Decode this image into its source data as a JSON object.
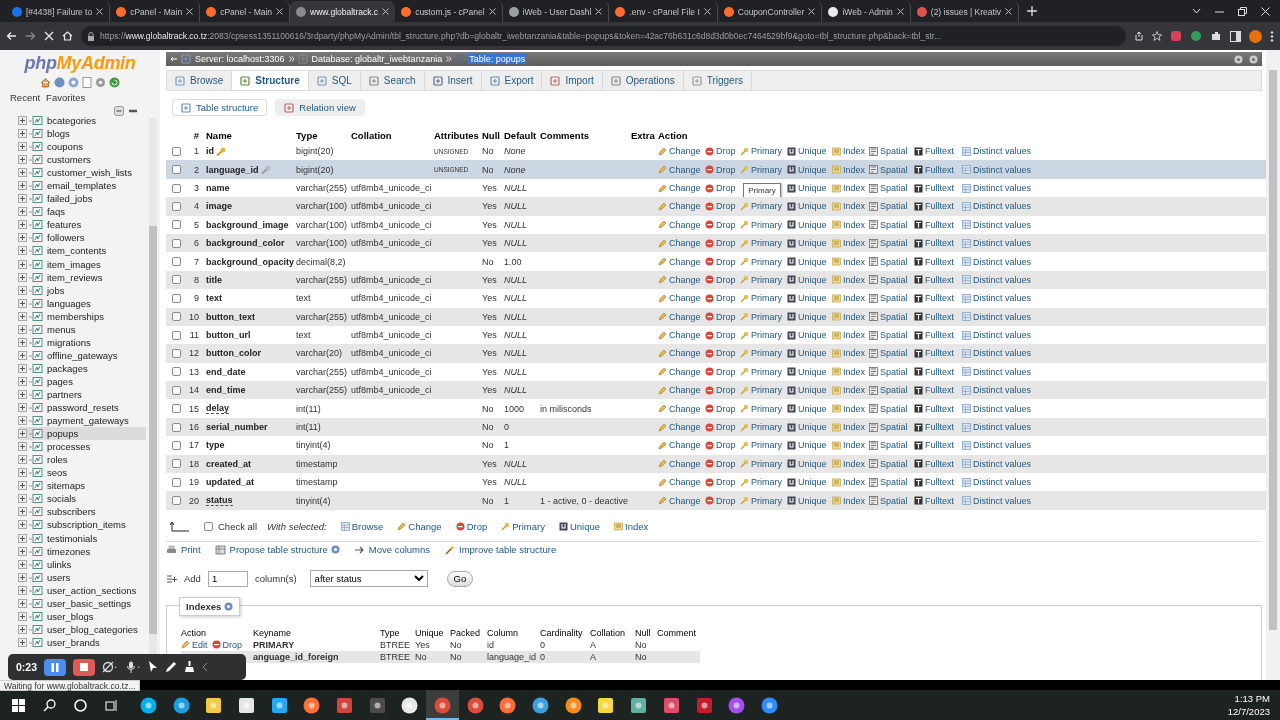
{
  "browser": {
    "tabs": [
      {
        "title": "[#4438] Failure to",
        "color": "#1a73e8",
        "selected": false
      },
      {
        "title": "cPanel - Main",
        "color": "#ff6c2c",
        "selected": false
      },
      {
        "title": "cPanel - Main",
        "color": "#ff6c2c",
        "selected": false
      },
      {
        "title": "www.globaltrack.c",
        "color": "#8a8a8a",
        "selected": true
      },
      {
        "title": "custom.js - cPanel",
        "color": "#ff6c2c",
        "selected": false
      },
      {
        "title": "iWeb - User Dashl",
        "color": "#9aa0a6",
        "selected": false
      },
      {
        "title": ".env - cPanel File I",
        "color": "#ff6c2c",
        "selected": false
      },
      {
        "title": "CouponController",
        "color": "#ff6c2c",
        "selected": false
      },
      {
        "title": "iWeb - Admin",
        "color": "#e8eaed",
        "selected": false
      },
      {
        "title": "(2) issues | Kreativ",
        "color": "#e0524a",
        "selected": false
      }
    ],
    "url": {
      "scheme": "https://",
      "host": "www.globaltrack.co.tz",
      "path": ":2083/cpsess1351100616/3rdparty/phpMyAdmin/tbl_structure.php?db=globaltr_iwebtanzania&table=popups&token=42ac76b631c6d8d3d0b0ec7464529bf9&goto=tbl_structure.php&back=tbl_str..."
    }
  },
  "sidebar": {
    "logo": [
      "php",
      "MyAdmin"
    ],
    "tabs": [
      {
        "label": "Recent"
      },
      {
        "label": "Favorites"
      }
    ],
    "tables": [
      {
        "name": "bcategories",
        "selected": false
      },
      {
        "name": "blogs",
        "selected": false
      },
      {
        "name": "coupons",
        "selected": false
      },
      {
        "name": "customers",
        "selected": false
      },
      {
        "name": "customer_wish_lists",
        "selected": false
      },
      {
        "name": "email_templates",
        "selected": false
      },
      {
        "name": "failed_jobs",
        "selected": false
      },
      {
        "name": "faqs",
        "selected": false
      },
      {
        "name": "features",
        "selected": false
      },
      {
        "name": "followers",
        "selected": false
      },
      {
        "name": "item_contents",
        "selected": false
      },
      {
        "name": "item_images",
        "selected": false
      },
      {
        "name": "item_reviews",
        "selected": false
      },
      {
        "name": "jobs",
        "selected": false
      },
      {
        "name": "languages",
        "selected": false
      },
      {
        "name": "memberships",
        "selected": false
      },
      {
        "name": "menus",
        "selected": false
      },
      {
        "name": "migrations",
        "selected": false
      },
      {
        "name": "offline_gateways",
        "selected": false
      },
      {
        "name": "packages",
        "selected": false
      },
      {
        "name": "pages",
        "selected": false
      },
      {
        "name": "partners",
        "selected": false
      },
      {
        "name": "password_resets",
        "selected": false
      },
      {
        "name": "payment_gateways",
        "selected": false
      },
      {
        "name": "popups",
        "selected": true
      },
      {
        "name": "processes",
        "selected": false
      },
      {
        "name": "roles",
        "selected": false
      },
      {
        "name": "seos",
        "selected": false
      },
      {
        "name": "sitemaps",
        "selected": false
      },
      {
        "name": "socials",
        "selected": false
      },
      {
        "name": "subscribers",
        "selected": false
      },
      {
        "name": "subscription_items",
        "selected": false
      },
      {
        "name": "testimonials",
        "selected": false
      },
      {
        "name": "timezones",
        "selected": false
      },
      {
        "name": "ulinks",
        "selected": false
      },
      {
        "name": "users",
        "selected": false
      },
      {
        "name": "user_action_sections",
        "selected": false
      },
      {
        "name": "user_basic_settings",
        "selected": false
      },
      {
        "name": "user_blogs",
        "selected": false
      },
      {
        "name": "user_blog_categories",
        "selected": false
      },
      {
        "name": "user_brands",
        "selected": false
      }
    ]
  },
  "breadcrumb": [
    {
      "label": "Server: localhost:3306",
      "selected": false
    },
    {
      "label": "Database: globaltr_iwebtanzania",
      "selected": false
    },
    {
      "label": "Table: popups",
      "selected": true
    }
  ],
  "tabs": [
    {
      "label": "Browse",
      "selected": false
    },
    {
      "label": "Structure",
      "selected": true
    },
    {
      "label": "SQL",
      "selected": false
    },
    {
      "label": "Search",
      "selected": false
    },
    {
      "label": "Insert",
      "selected": false
    },
    {
      "label": "Export",
      "selected": false
    },
    {
      "label": "Import",
      "selected": false
    },
    {
      "label": "Operations",
      "selected": false
    },
    {
      "label": "Triggers",
      "selected": false
    }
  ],
  "subtabs": [
    {
      "label": "Table structure",
      "selected": true
    },
    {
      "label": "Relation view",
      "selected": false
    }
  ],
  "structure": {
    "columns": [
      "#",
      "Name",
      "Type",
      "Collation",
      "Attributes",
      "Null",
      "Default",
      "Comments",
      "Extra",
      "Action"
    ],
    "rows": [
      {
        "num": "1",
        "name": "id",
        "kind": "primary",
        "type": "bigint(20)",
        "attributes": "UNSIGNED",
        "null": "No",
        "default": "None",
        "default_special": true,
        "checked": false,
        "highlighted": false,
        "commented": false,
        "actions": [
          "Change",
          "Drop",
          "Primary",
          "Unique",
          "Index",
          "Spatial",
          "Fulltext",
          "Distinct values"
        ]
      },
      {
        "num": "2",
        "name": "language_id",
        "kind": "index",
        "type": "bigint(20)",
        "attributes": "UNSIGNED",
        "null": "No",
        "default": "None",
        "default_special": true,
        "checked": false,
        "highlighted": true,
        "commented": false,
        "actions": [
          "Change",
          "Drop",
          "Primary",
          "Unique",
          "Index",
          "Spatial",
          "Fulltext",
          "Distinct values"
        ]
      },
      {
        "num": "3",
        "name": "name",
        "type": "varchar(255)",
        "collation": "utf8mb4_unicode_ci",
        "null": "Yes",
        "default": "NULL",
        "default_special": true,
        "checked": false,
        "highlighted": false,
        "commented": false,
        "tooltip": "Primary",
        "actions": [
          "Change",
          "Drop",
          "Unique",
          "Index",
          "Spatial",
          "Fulltext",
          "Distinct values"
        ]
      },
      {
        "num": "4",
        "name": "image",
        "type": "varchar(100)",
        "collation": "utf8mb4_unicode_ci",
        "null": "Yes",
        "default": "NULL",
        "default_special": true,
        "checked": false,
        "highlighted": false,
        "commented": false,
        "actions": [
          "Change",
          "Drop",
          "Primary",
          "Unique",
          "Index",
          "Spatial",
          "Fulltext",
          "Distinct values"
        ]
      },
      {
        "num": "5",
        "name": "background_image",
        "type": "varchar(100)",
        "collation": "utf8mb4_unicode_ci",
        "null": "Yes",
        "default": "NULL",
        "default_special": true,
        "checked": false,
        "highlighted": false,
        "commented": false,
        "actions": [
          "Change",
          "Drop",
          "Primary",
          "Unique",
          "Index",
          "Spatial",
          "Fulltext",
          "Distinct values"
        ]
      },
      {
        "num": "6",
        "name": "background_color",
        "type": "varchar(100)",
        "collation": "utf8mb4_unicode_ci",
        "null": "Yes",
        "default": "NULL",
        "default_special": true,
        "checked": false,
        "highlighted": false,
        "commented": false,
        "actions": [
          "Change",
          "Drop",
          "Primary",
          "Unique",
          "Index",
          "Spatial",
          "Fulltext",
          "Distinct values"
        ]
      },
      {
        "num": "7",
        "name": "background_opacity",
        "type": "decimal(8,2)",
        "null": "No",
        "default": "1.00",
        "default_special": false,
        "checked": false,
        "highlighted": false,
        "commented": false,
        "actions": [
          "Change",
          "Drop",
          "Primary",
          "Unique",
          "Index",
          "Spatial",
          "Fulltext",
          "Distinct values"
        ]
      },
      {
        "num": "8",
        "name": "title",
        "type": "varchar(255)",
        "collation": "utf8mb4_unicode_ci",
        "null": "Yes",
        "default": "NULL",
        "default_special": true,
        "checked": false,
        "highlighted": false,
        "commented": false,
        "actions": [
          "Change",
          "Drop",
          "Primary",
          "Unique",
          "Index",
          "Spatial",
          "Fulltext",
          "Distinct values"
        ]
      },
      {
        "num": "9",
        "name": "text",
        "type": "text",
        "collation": "utf8mb4_unicode_ci",
        "null": "Yes",
        "default": "NULL",
        "default_special": true,
        "checked": false,
        "highlighted": false,
        "commented": false,
        "actions": [
          "Change",
          "Drop",
          "Primary",
          "Unique",
          "Index",
          "Spatial",
          "Fulltext",
          "Distinct values"
        ]
      },
      {
        "num": "10",
        "name": "button_text",
        "type": "varchar(255)",
        "collation": "utf8mb4_unicode_ci",
        "null": "Yes",
        "default": "NULL",
        "default_special": true,
        "checked": false,
        "highlighted": false,
        "commented": false,
        "actions": [
          "Change",
          "Drop",
          "Primary",
          "Unique",
          "Index",
          "Spatial",
          "Fulltext",
          "Distinct values"
        ]
      },
      {
        "num": "11",
        "name": "button_url",
        "type": "text",
        "collation": "utf8mb4_unicode_ci",
        "null": "Yes",
        "default": "NULL",
        "default_special": true,
        "checked": false,
        "highlighted": false,
        "commented": false,
        "actions": [
          "Change",
          "Drop",
          "Primary",
          "Unique",
          "Index",
          "Spatial",
          "Fulltext",
          "Distinct values"
        ]
      },
      {
        "num": "12",
        "name": "button_color",
        "type": "varchar(20)",
        "collation": "utf8mb4_unicode_ci",
        "null": "Yes",
        "default": "NULL",
        "default_special": true,
        "checked": false,
        "highlighted": false,
        "commented": false,
        "actions": [
          "Change",
          "Drop",
          "Primary",
          "Unique",
          "Index",
          "Spatial",
          "Fulltext",
          "Distinct values"
        ]
      },
      {
        "num": "13",
        "name": "end_date",
        "type": "varchar(255)",
        "collation": "utf8mb4_unicode_ci",
        "null": "Yes",
        "default": "NULL",
        "default_special": true,
        "checked": false,
        "highlighted": false,
        "commented": false,
        "actions": [
          "Change",
          "Drop",
          "Primary",
          "Unique",
          "Index",
          "Spatial",
          "Fulltext",
          "Distinct values"
        ]
      },
      {
        "num": "14",
        "name": "end_time",
        "type": "varchar(255)",
        "collation": "utf8mb4_unicode_ci",
        "null": "Yes",
        "default": "NULL",
        "default_special": true,
        "checked": false,
        "highlighted": false,
        "commented": false,
        "actions": [
          "Change",
          "Drop",
          "Primary",
          "Unique",
          "Index",
          "Spatial",
          "Fulltext",
          "Distinct values"
        ]
      },
      {
        "num": "15",
        "name": "delay",
        "type": "int(11)",
        "null": "No",
        "default": "1000",
        "default_special": false,
        "comments": "in milisconds",
        "checked": false,
        "highlighted": false,
        "commented": true,
        "actions": [
          "Change",
          "Drop",
          "Primary",
          "Unique",
          "Index",
          "Spatial",
          "Fulltext",
          "Distinct values"
        ]
      },
      {
        "num": "16",
        "name": "serial_number",
        "type": "int(11)",
        "null": "No",
        "default": "0",
        "default_special": false,
        "checked": false,
        "highlighted": false,
        "commented": false,
        "actions": [
          "Change",
          "Drop",
          "Primary",
          "Unique",
          "Index",
          "Spatial",
          "Fulltext",
          "Distinct values"
        ]
      },
      {
        "num": "17",
        "name": "type",
        "type": "tinyint(4)",
        "null": "No",
        "default": "1",
        "default_special": false,
        "checked": false,
        "highlighted": false,
        "commented": false,
        "actions": [
          "Change",
          "Drop",
          "Primary",
          "Unique",
          "Index",
          "Spatial",
          "Fulltext",
          "Distinct values"
        ]
      },
      {
        "num": "18",
        "name": "created_at",
        "type": "timestamp",
        "null": "Yes",
        "default": "NULL",
        "default_special": true,
        "checked": false,
        "highlighted": false,
        "commented": false,
        "actions": [
          "Change",
          "Drop",
          "Primary",
          "Unique",
          "Index",
          "Spatial",
          "Fulltext",
          "Distinct values"
        ]
      },
      {
        "num": "19",
        "name": "updated_at",
        "type": "timestamp",
        "null": "Yes",
        "default": "NULL",
        "default_special": true,
        "checked": false,
        "highlighted": false,
        "commented": false,
        "actions": [
          "Change",
          "Drop",
          "Primary",
          "Unique",
          "Index",
          "Spatial",
          "Fulltext",
          "Distinct values"
        ]
      },
      {
        "num": "20",
        "name": "status",
        "type": "tinyint(4)",
        "null": "No",
        "default": "1",
        "default_special": false,
        "comments": "1 - active, 0 - deactive",
        "checked": false,
        "highlighted": false,
        "commented": true,
        "actions": [
          "Change",
          "Drop",
          "Primary",
          "Unique",
          "Index",
          "Spatial",
          "Fulltext",
          "Distinct values"
        ]
      }
    ]
  },
  "bulk": {
    "check_all": {
      "label": "Check all",
      "checked": false
    },
    "with_selected": "With selected:",
    "actions": [
      "Browse",
      "Change",
      "Drop",
      "Primary",
      "Unique",
      "Index"
    ]
  },
  "tools": [
    {
      "label": "Print",
      "help": false
    },
    {
      "label": "Propose table structure",
      "help": true
    },
    {
      "label": "Move columns",
      "help": false
    },
    {
      "label": "Improve table structure",
      "help": false
    }
  ],
  "add": {
    "label": "Add",
    "value": "1",
    "unit": "column(s)",
    "position": "after status",
    "button": "Go"
  },
  "indexes": {
    "title": "Indexes",
    "columns": [
      "Action",
      "Keyname",
      "Type",
      "Unique",
      "Packed",
      "Column",
      "Cardinality",
      "Collation",
      "Null",
      "Comment"
    ],
    "rows": [
      {
        "actions": [
          "Edit",
          "Drop"
        ],
        "keyname": "PRIMARY",
        "type": "BTREE",
        "unique": "Yes",
        "packed": "No",
        "column": "id",
        "cardinality": "0",
        "collation": "A",
        "null": "No"
      },
      {
        "keyname": "anguage_id_foreign",
        "type": "BTREE",
        "unique": "No",
        "packed": "No",
        "column": "language_id",
        "cardinality": "0",
        "collation": "A",
        "null": "No"
      }
    ]
  },
  "recorder": {
    "time": "0:23"
  },
  "status": "Waiting for www.globaltrack.co.tz...",
  "taskbar": {
    "apps": [
      {
        "kind": "skype",
        "selected": false
      },
      {
        "kind": "edge",
        "selected": false
      },
      {
        "kind": "files",
        "selected": false
      },
      {
        "kind": "store",
        "selected": false
      },
      {
        "kind": "vscode",
        "selected": false
      },
      {
        "kind": "firefox",
        "selected": false
      },
      {
        "kind": "power",
        "selected": false
      },
      {
        "kind": "sublime",
        "selected": false
      },
      {
        "kind": "slack",
        "selected": false
      },
      {
        "kind": "chrome",
        "selected": true
      },
      {
        "kind": "chrome",
        "selected": false
      },
      {
        "kind": "postman",
        "selected": false
      },
      {
        "kind": "elephant",
        "selected": false
      },
      {
        "kind": "finder",
        "selected": false
      },
      {
        "kind": "notes",
        "selected": false
      },
      {
        "kind": "vpn",
        "selected": false
      },
      {
        "kind": "robot",
        "selected": false
      },
      {
        "kind": "filezilla",
        "selected": false
      },
      {
        "kind": "messenger",
        "selected": false
      },
      {
        "kind": "zoom",
        "selected": false
      }
    ],
    "time": "1:13 PM",
    "date": "12/7/2023"
  }
}
